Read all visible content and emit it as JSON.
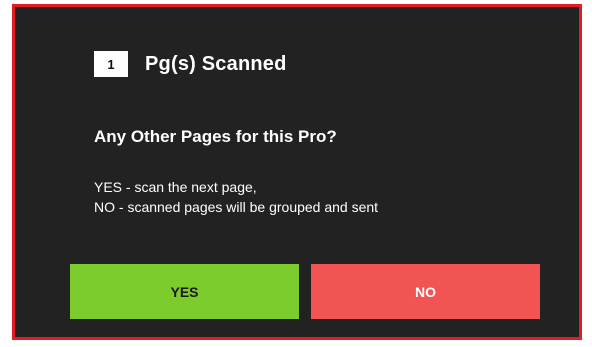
{
  "dialog": {
    "page_count": "1",
    "header_title": "Pg(s) Scanned",
    "question": "Any Other Pages for this Pro?",
    "instructions": [
      "YES - scan the next page,",
      "NO - scanned pages will be grouped and sent"
    ],
    "yes_label": "YES",
    "no_label": "NO"
  },
  "colors": {
    "background": "#222222",
    "border": "#e31b23",
    "yes_button": "#7ccc2e",
    "no_button": "#f25353"
  }
}
